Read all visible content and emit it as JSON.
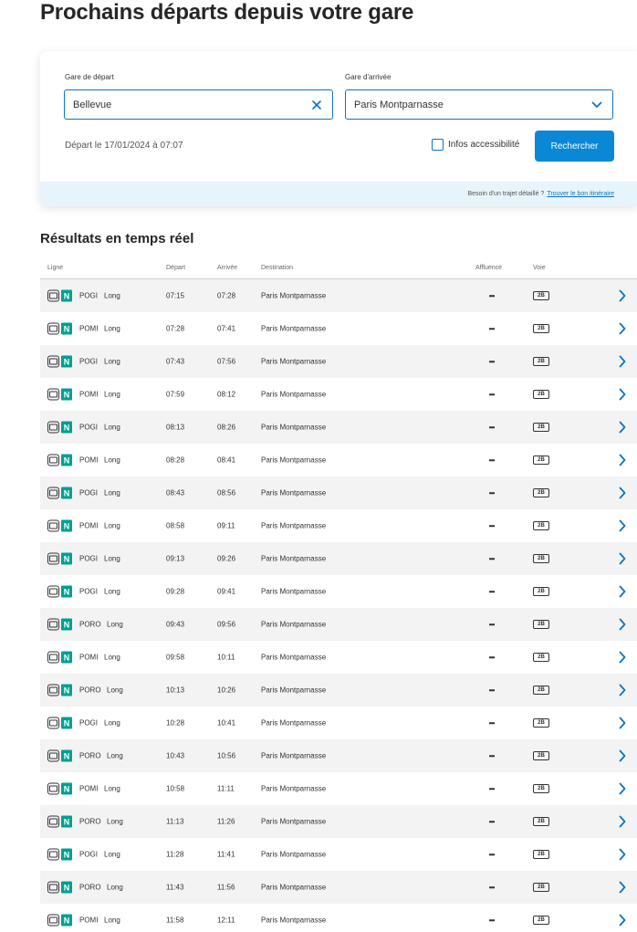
{
  "page": {
    "title": "Prochains départs depuis votre gare"
  },
  "search": {
    "from_label": "Gare de départ",
    "from_value": "Bellevue",
    "to_label": "Gare d'arrivée",
    "to_value": "Paris Montparnasse",
    "depart_text": "Départ le 17/01/2024 à 07:07",
    "accessibility_label": "Infos accessibilité",
    "accessibility_checked": false,
    "search_button": "Rechercher",
    "footer_text": "Besoin d'un trajet détaillé ?",
    "footer_link": "Trouver le bon itinéraire"
  },
  "results": {
    "title": "Résultats en temps réel",
    "columns": {
      "line": "Ligne",
      "departure": "Départ",
      "arrival": "Arrivée",
      "destination": "Destination",
      "affluence": "Affluence",
      "platform": "Voie"
    },
    "line_badge": "N",
    "rows": [
      {
        "mission": "POGI",
        "length": "Long",
        "departure": "07:15",
        "arrival": "07:28",
        "destination": "Paris Montparnasse",
        "platform": "2B"
      },
      {
        "mission": "POMI",
        "length": "Long",
        "departure": "07:28",
        "arrival": "07:41",
        "destination": "Paris Montparnasse",
        "platform": "2B"
      },
      {
        "mission": "POGI",
        "length": "Long",
        "departure": "07:43",
        "arrival": "07:56",
        "destination": "Paris Montparnasse",
        "platform": "2B"
      },
      {
        "mission": "POMI",
        "length": "Long",
        "departure": "07:59",
        "arrival": "08:12",
        "destination": "Paris Montparnasse",
        "platform": "2B"
      },
      {
        "mission": "POGI",
        "length": "Long",
        "departure": "08:13",
        "arrival": "08:26",
        "destination": "Paris Montparnasse",
        "platform": "2B"
      },
      {
        "mission": "POMI",
        "length": "Long",
        "departure": "08:28",
        "arrival": "08:41",
        "destination": "Paris Montparnasse",
        "platform": "2B"
      },
      {
        "mission": "POGI",
        "length": "Long",
        "departure": "08:43",
        "arrival": "08:56",
        "destination": "Paris Montparnasse",
        "platform": "2B"
      },
      {
        "mission": "POMI",
        "length": "Long",
        "departure": "08:58",
        "arrival": "09:11",
        "destination": "Paris Montparnasse",
        "platform": "2B"
      },
      {
        "mission": "POGI",
        "length": "Long",
        "departure": "09:13",
        "arrival": "09:26",
        "destination": "Paris Montparnasse",
        "platform": "2B"
      },
      {
        "mission": "POGI",
        "length": "Long",
        "departure": "09:28",
        "arrival": "09:41",
        "destination": "Paris Montparnasse",
        "platform": "2B"
      },
      {
        "mission": "PORO",
        "length": "Long",
        "departure": "09:43",
        "arrival": "09:56",
        "destination": "Paris Montparnasse",
        "platform": "2B"
      },
      {
        "mission": "POMI",
        "length": "Long",
        "departure": "09:58",
        "arrival": "10:11",
        "destination": "Paris Montparnasse",
        "platform": "2B"
      },
      {
        "mission": "PORO",
        "length": "Long",
        "departure": "10:13",
        "arrival": "10:26",
        "destination": "Paris Montparnasse",
        "platform": "2B"
      },
      {
        "mission": "POGI",
        "length": "Long",
        "departure": "10:28",
        "arrival": "10:41",
        "destination": "Paris Montparnasse",
        "platform": "2B"
      },
      {
        "mission": "PORO",
        "length": "Long",
        "departure": "10:43",
        "arrival": "10:56",
        "destination": "Paris Montparnasse",
        "platform": "2B"
      },
      {
        "mission": "POMI",
        "length": "Long",
        "departure": "10:58",
        "arrival": "11:11",
        "destination": "Paris Montparnasse",
        "platform": "2B"
      },
      {
        "mission": "PORO",
        "length": "Long",
        "departure": "11:13",
        "arrival": "11:26",
        "destination": "Paris Montparnasse",
        "platform": "2B"
      },
      {
        "mission": "POGI",
        "length": "Long",
        "departure": "11:28",
        "arrival": "11:41",
        "destination": "Paris Montparnasse",
        "platform": "2B"
      },
      {
        "mission": "PORO",
        "length": "Long",
        "departure": "11:43",
        "arrival": "11:56",
        "destination": "Paris Montparnasse",
        "platform": "2B"
      },
      {
        "mission": "POMI",
        "length": "Long",
        "departure": "11:58",
        "arrival": "12:11",
        "destination": "Paris Montparnasse",
        "platform": "2B"
      }
    ]
  },
  "icons": {
    "train": "train-icon",
    "clear": "close-icon",
    "dropdown": "chevron-down-icon",
    "row_action": "chevron-right-icon",
    "affluence": "dash-icon"
  },
  "colors": {
    "accent": "#0a88d6",
    "line_n": "#00a092",
    "footer_bg": "#e8f4fb"
  }
}
